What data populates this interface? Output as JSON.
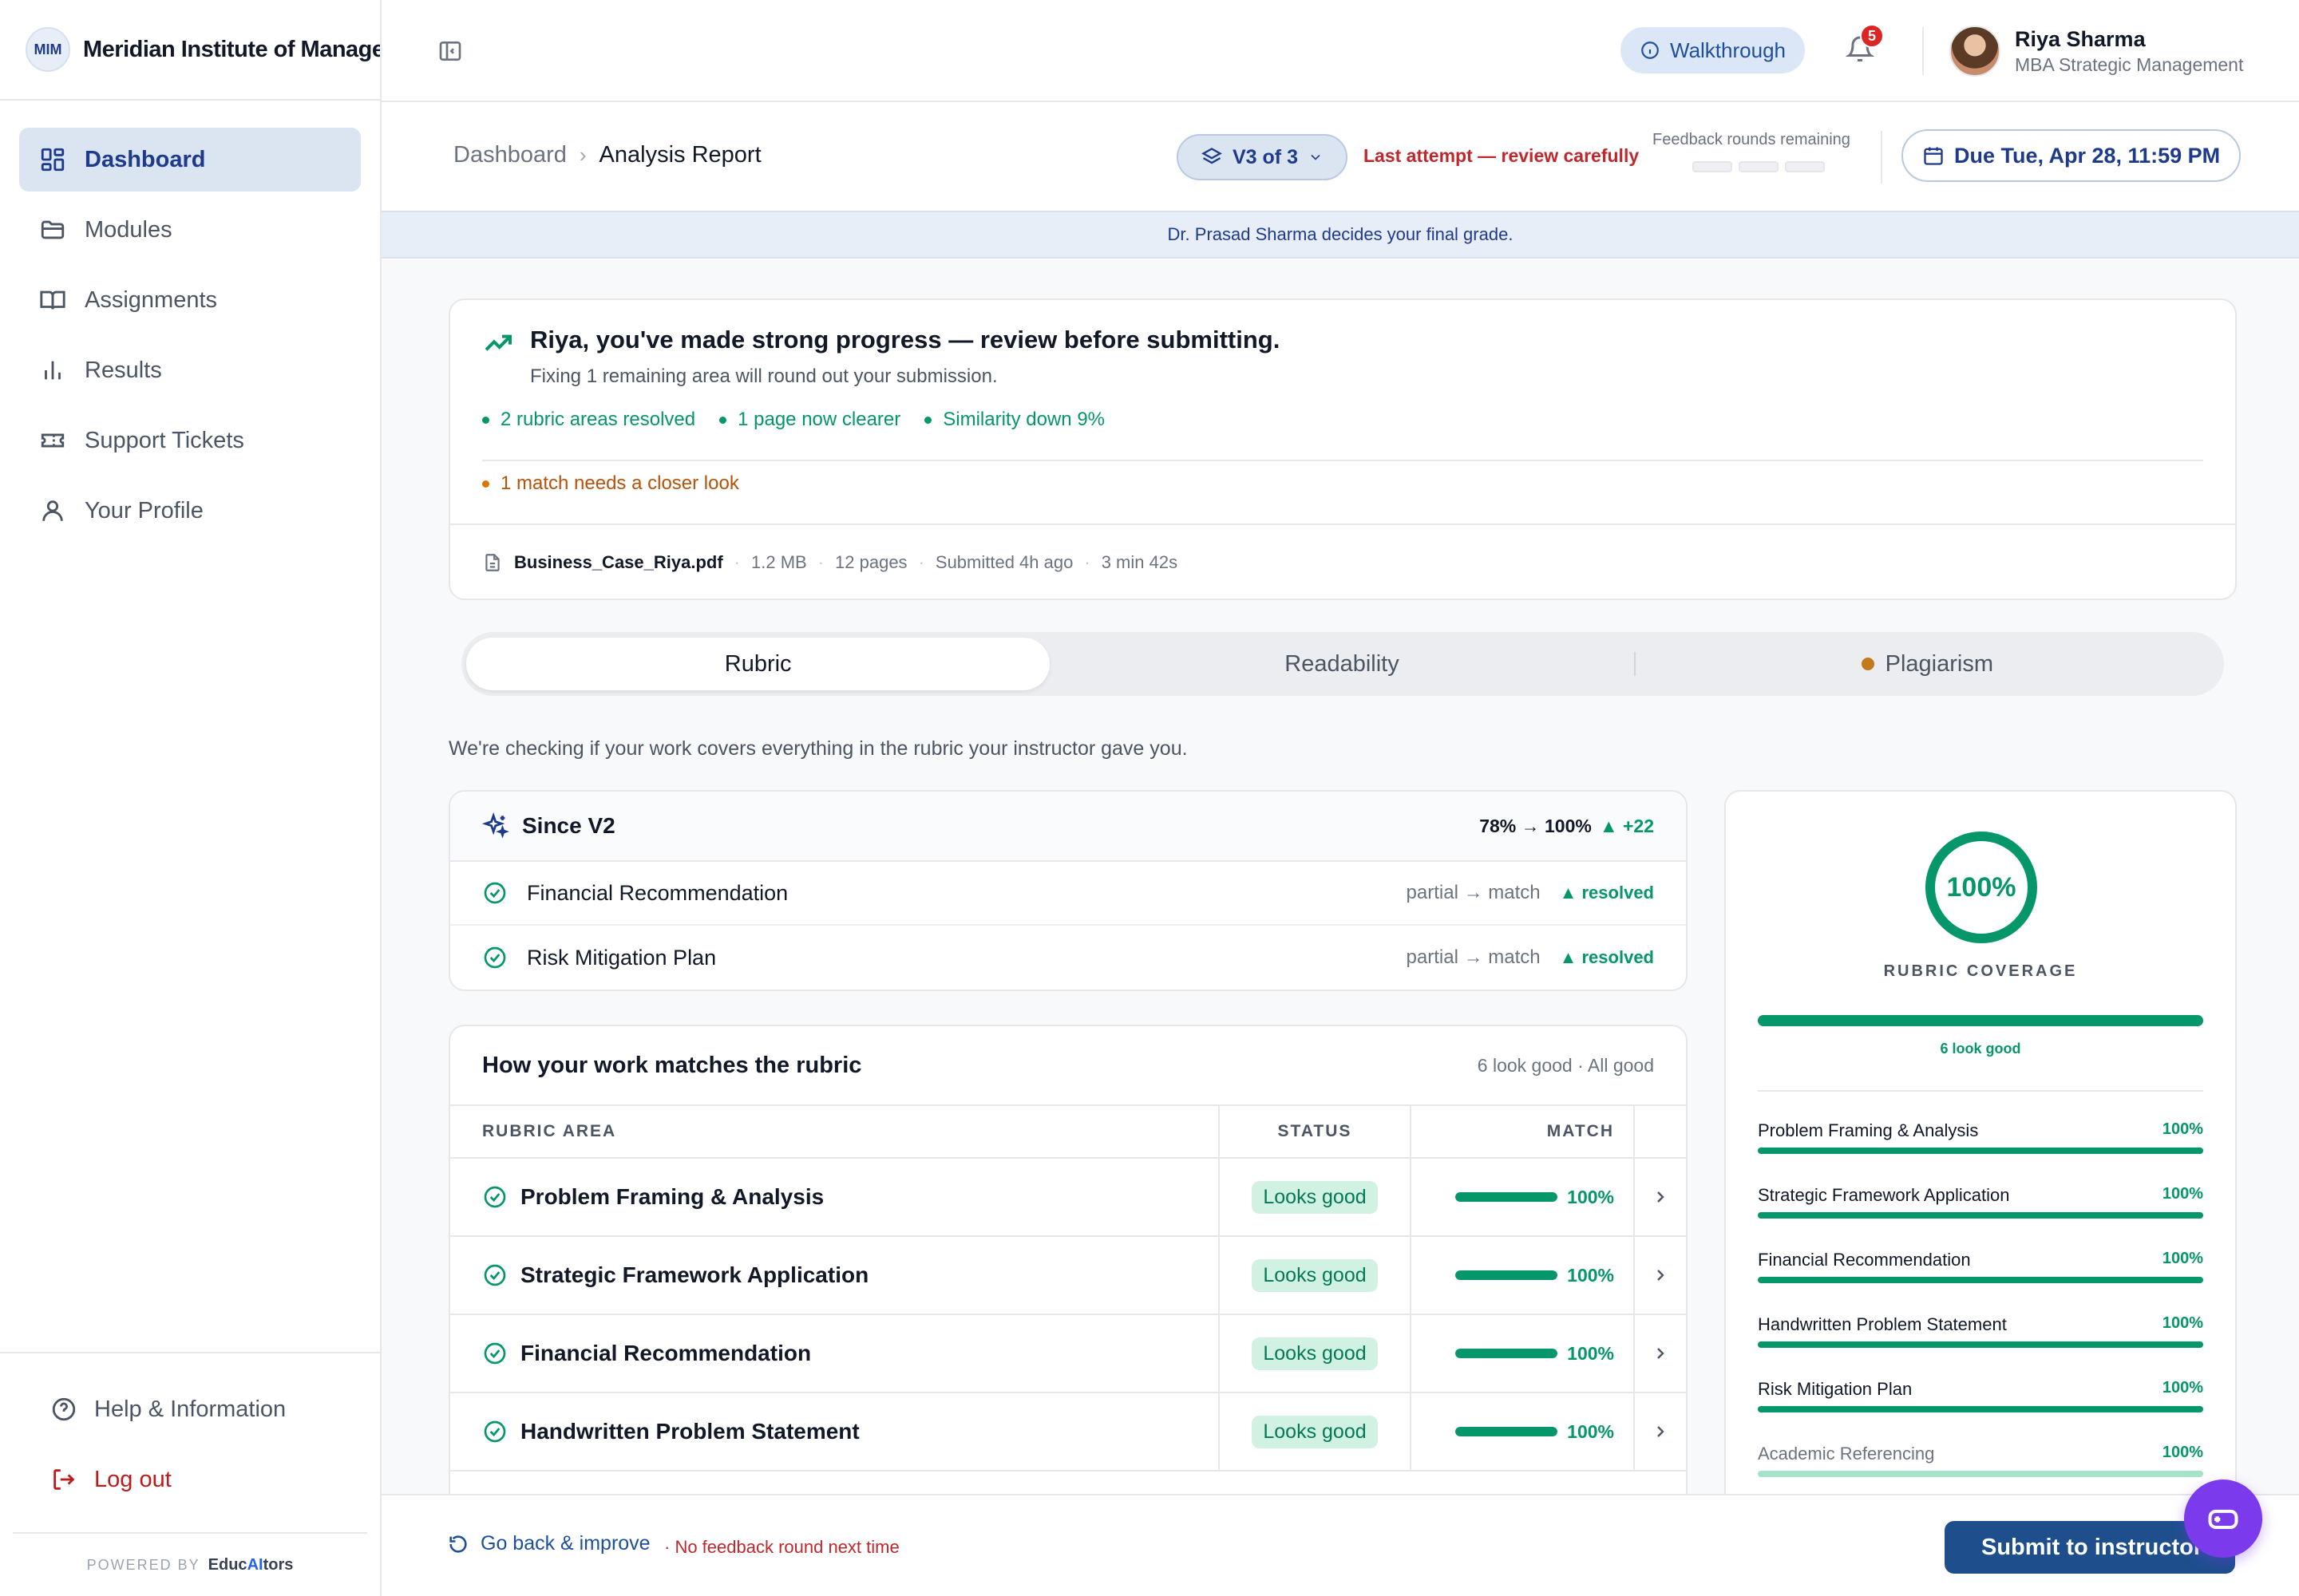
{
  "brand": {
    "logo": "MIM",
    "name": "Meridian Institute of Management"
  },
  "sidebar": {
    "items": [
      {
        "label": "Dashboard",
        "icon": "dashboard-icon",
        "active": true
      },
      {
        "label": "Modules",
        "icon": "folder-icon"
      },
      {
        "label": "Assignments",
        "icon": "book-icon"
      },
      {
        "label": "Results",
        "icon": "bar-chart-icon"
      },
      {
        "label": "Support Tickets",
        "icon": "ticket-icon"
      },
      {
        "label": "Your Profile",
        "icon": "user-icon"
      }
    ],
    "help_label": "Help & Information",
    "logout_label": "Log out",
    "powered_by": "POWERED BY",
    "powered_brand_a": "Educ",
    "powered_brand_b": "AI",
    "powered_brand_c": "tors"
  },
  "topbar": {
    "walkthrough_label": "Walkthrough",
    "notifications_count": "5",
    "user_name": "Riya Sharma",
    "user_program": "MBA Strategic Management"
  },
  "header": {
    "breadcrumb_root": "Dashboard",
    "breadcrumb_current": "Analysis Report",
    "version_label": "V3 of 3",
    "last_attempt": "Last attempt — review carefully",
    "feedback_label": "Feedback rounds remaining",
    "due_label": "Due Tue, Apr 28, 11:59 PM"
  },
  "notice": "Dr. Prasad Sharma decides your final grade.",
  "progress_card": {
    "title": "Riya, you've made strong progress — review before submitting.",
    "subtitle": "Fixing 1 remaining area will round out your submission.",
    "chips": [
      "2 rubric areas resolved",
      "1 page now clearer",
      "Similarity down 9%"
    ],
    "warning": "1 match needs a closer look",
    "file_name": "Business_Case_Riya.pdf",
    "file_size": "1.2 MB",
    "pages": "12 pages",
    "submitted": "Submitted 4h ago",
    "duration": "3 min 42s"
  },
  "tabs": [
    {
      "label": "Rubric",
      "active": true
    },
    {
      "label": "Readability"
    },
    {
      "label": "Plagiarism",
      "dot": true
    }
  ],
  "intro": "We're checking if your work covers everything in the rubric your instructor gave you.",
  "since": {
    "title": "Since V2",
    "delta": "78% → 100%",
    "delta_change": "▲ +22",
    "rows": [
      {
        "name": "Financial Recommendation",
        "change": "partial → match",
        "result": "▲ resolved"
      },
      {
        "name": "Risk Mitigation Plan",
        "change": "partial → match",
        "result": "▲ resolved"
      }
    ]
  },
  "rubric": {
    "title": "How your work matches the rubric",
    "summary": "6 look good · All good",
    "col_area": "RUBRIC AREA",
    "col_status": "STATUS",
    "col_match": "MATCH",
    "rows": [
      {
        "name": "Problem Framing & Analysis",
        "status": "Looks good",
        "match_label": "100%",
        "match": 1.0
      },
      {
        "name": "Strategic Framework Application",
        "status": "Looks good",
        "match_label": "100%",
        "match": 1.0
      },
      {
        "name": "Financial Recommendation",
        "status": "Looks good",
        "match_label": "100%",
        "match": 1.0
      },
      {
        "name": "Handwritten Problem Statement",
        "status": "Looks good",
        "match_label": "100%",
        "match": 1.0
      }
    ]
  },
  "coverage": {
    "value": "100%",
    "label": "RUBRIC COVERAGE",
    "fill": 1.0,
    "note": "6 look good",
    "items": [
      {
        "name": "Problem Framing & Analysis",
        "value": "100%",
        "fill": 1.0
      },
      {
        "name": "Strategic Framework Application",
        "value": "100%",
        "fill": 1.0
      },
      {
        "name": "Financial Recommendation",
        "value": "100%",
        "fill": 1.0
      },
      {
        "name": "Handwritten Problem Statement",
        "value": "100%",
        "fill": 1.0
      },
      {
        "name": "Risk Mitigation Plan",
        "value": "100%",
        "fill": 1.0
      },
      {
        "name": "Academic Referencing",
        "value": "100%",
        "fill": 1.0
      }
    ]
  },
  "footer": {
    "go_back": "Go back & improve",
    "no_feedback": "· No feedback round next time",
    "submit": "Submit to instructor"
  },
  "colors": {
    "accent": "#1e3a8a",
    "success": "#059669",
    "warning": "#b45309",
    "danger": "#c0272d",
    "fab": "#7c3aed"
  }
}
